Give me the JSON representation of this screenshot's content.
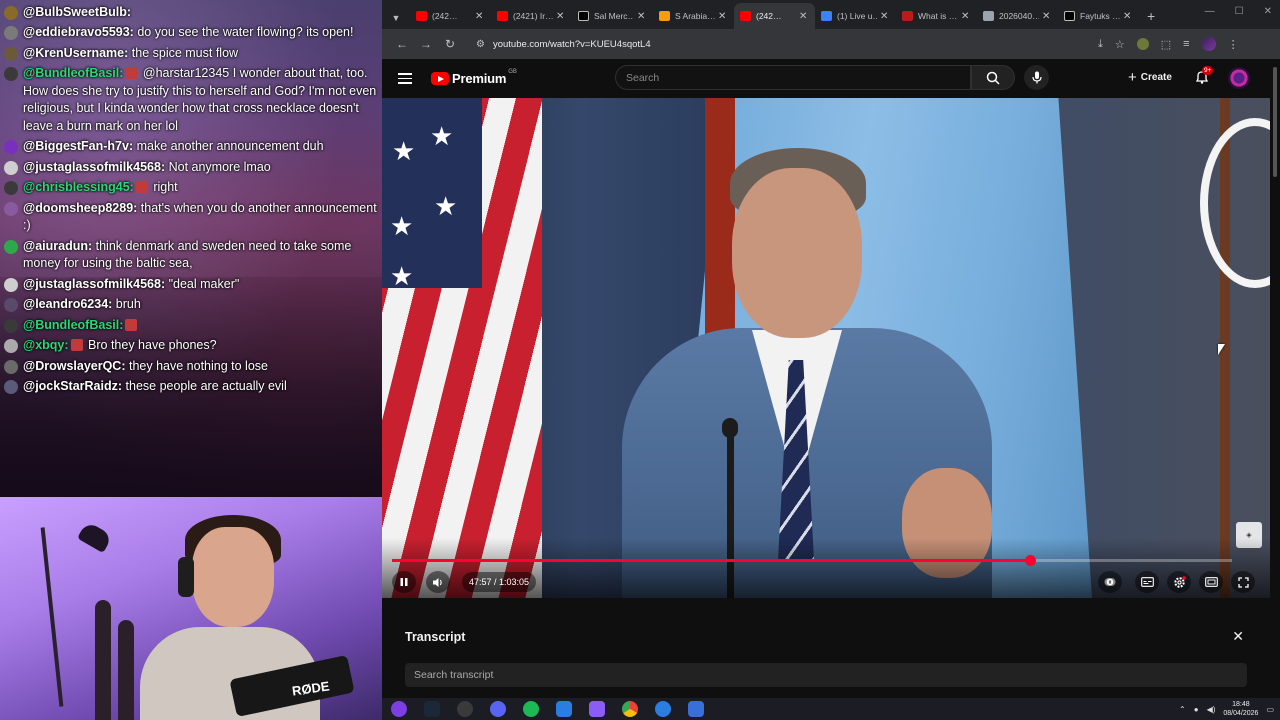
{
  "chat": {
    "messages": [
      {
        "user": "@BulbSweetBulb:",
        "text": "",
        "user_color": "#ffffff",
        "avatar_color": "#8a6a2a"
      },
      {
        "user": "@eddiebravo5593:",
        "text": "do you see the water flowing? its open!",
        "user_color": "#ffffff",
        "avatar_color": "#7a7a7a"
      },
      {
        "user": "@KrenUsername:",
        "text": "the spice must flow",
        "user_color": "#ffffff",
        "avatar_color": "#6a5a3a"
      },
      {
        "user": "@BundleofBasil:",
        "text": "@harstar12345 I wonder about that, too. How does she try to justify this to herself and God? I'm not even religious, but I kinda wonder how that cross necklace doesn't leave a burn mark on her lol",
        "user_color": "#2ed573",
        "avatar_color": "#3a3a3a"
      },
      {
        "user": "@BiggestFan-h7v:",
        "text": "make another announcement duh",
        "user_color": "#ffffff",
        "avatar_color": "#7b2fbe"
      },
      {
        "user": "@justaglassofmilk4568:",
        "text": "Not anymore lmao",
        "user_color": "#ffffff",
        "avatar_color": "#cfcfcf"
      },
      {
        "user": "@chrisblessing45:",
        "text": "right",
        "user_color": "#2ed573",
        "avatar_color": "#3a3a3a"
      },
      {
        "user": "@doomsheep8289:",
        "text": "that's when you do another announcement :)",
        "user_color": "#ffffff",
        "avatar_color": "#8a5aa0"
      },
      {
        "user": "@aiuradun:",
        "text": "think denmark and sweden need to take some money for using the baltic sea,",
        "user_color": "#ffffff",
        "avatar_color": "#2ea84a"
      },
      {
        "user": "@justaglassofmilk4568:",
        "text": "\"deal maker\"",
        "user_color": "#ffffff",
        "avatar_color": "#cfcfcf"
      },
      {
        "user": "@leandro6234:",
        "text": "bruh",
        "user_color": "#ffffff",
        "avatar_color": "#5a4a6a"
      },
      {
        "user": "@BundleofBasil:",
        "text": "",
        "user_color": "#2ed573",
        "avatar_color": "#3a3a3a"
      },
      {
        "user": "@xbqy:",
        "text": "Bro they have phones?",
        "user_color": "#2ed573",
        "avatar_color": "#aaaaaa"
      },
      {
        "user": "@DrowslayerQC:",
        "text": "they have nothing to lose",
        "user_color": "#ffffff",
        "avatar_color": "#6a6a6a"
      },
      {
        "user": "@jockStarRaidz:",
        "text": "these people are actually evil",
        "user_color": "#ffffff",
        "avatar_color": "#5a5a7a"
      }
    ]
  },
  "webcam": {
    "mic_brand": "RØDE"
  },
  "browser": {
    "tabs": [
      {
        "label": "(242…",
        "favicon": "youtube",
        "active": false
      },
      {
        "label": "(2421) Ir…",
        "favicon": "youtube",
        "active": false
      },
      {
        "label": "Sal Merc…",
        "favicon": "x",
        "active": false
      },
      {
        "label": "S Arabia…",
        "favicon": "orange",
        "active": false
      },
      {
        "label": "(242…",
        "favicon": "youtube",
        "active": true
      },
      {
        "label": "(1) Live u…",
        "favicon": "liveua",
        "active": false
      },
      {
        "label": "What is …",
        "favicon": "flag",
        "active": false
      },
      {
        "label": "2026040…",
        "favicon": "globe",
        "active": false
      },
      {
        "label": "Faytuks …",
        "favicon": "x",
        "active": false
      }
    ],
    "url": "youtube.com/watch?v=KUEU4sqotL4"
  },
  "youtube": {
    "brand": "Premium",
    "region": "GB",
    "search_placeholder": "Search",
    "create_label": "Create",
    "notifications_badge": "9+"
  },
  "player": {
    "current_time": "47:57",
    "duration": "1:03:05",
    "time_display": "47:57 / 1:03:05",
    "progress_fraction": 0.7601
  },
  "transcript": {
    "title": "Transcript",
    "search_placeholder": "Search transcript"
  },
  "taskbar": {
    "time": "18:48",
    "date": "08/04/2026"
  },
  "colors": {
    "yt_red": "#ff0000",
    "progress_red": "#ff0033",
    "chat_green": "#2ed573"
  }
}
